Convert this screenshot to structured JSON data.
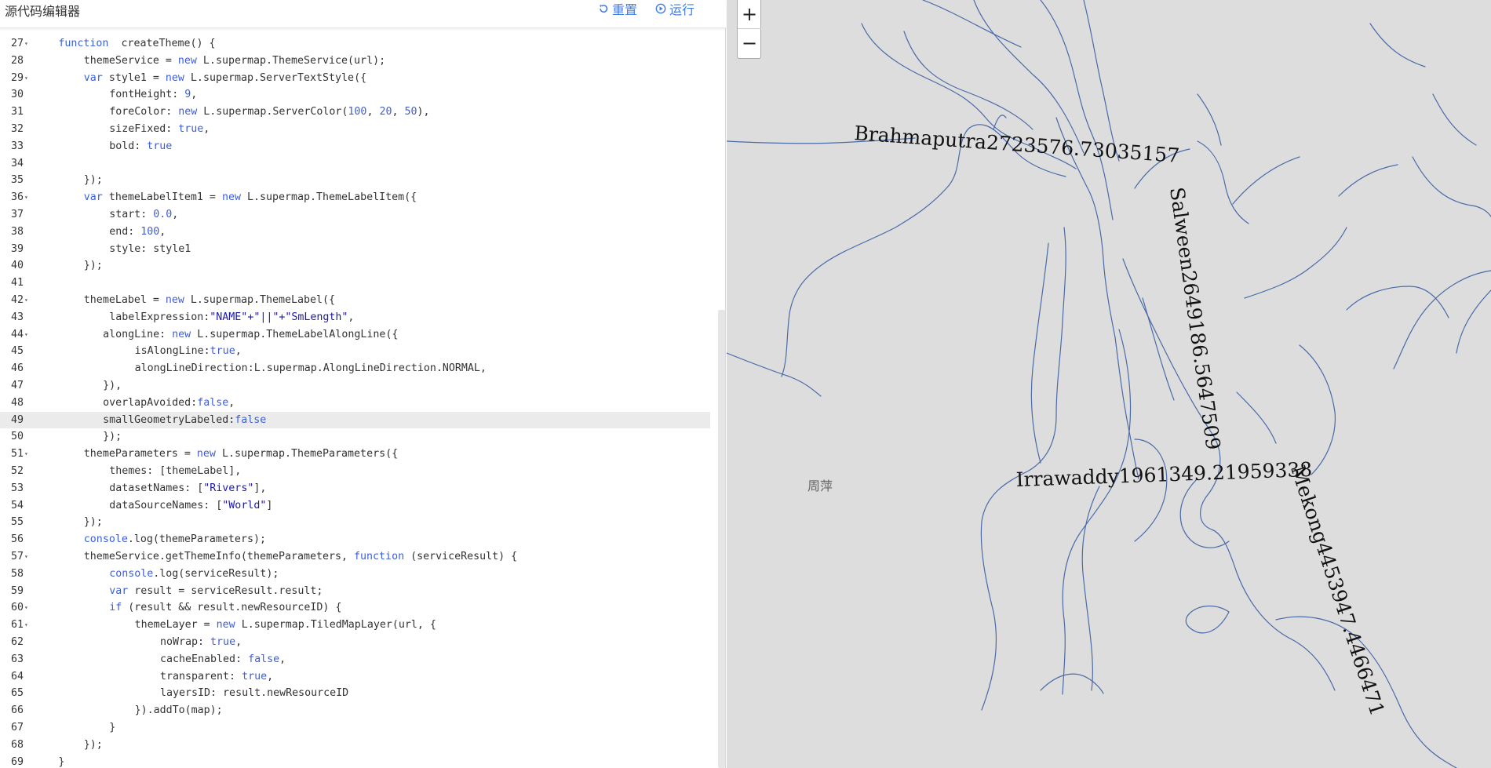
{
  "editor": {
    "title": "源代码编辑器",
    "reset_label": "重置",
    "run_label": "运行",
    "lines": [
      {
        "n": "27",
        "fold": true,
        "indent": 4,
        "tokens": [
          [
            "kw",
            "function"
          ],
          [
            "",
            "  createTheme() {"
          ]
        ]
      },
      {
        "n": "28",
        "fold": false,
        "indent": 8,
        "tokens": [
          [
            "",
            "themeService = "
          ],
          [
            "kw",
            "new"
          ],
          [
            "",
            " L.supermap.ThemeService(url);"
          ]
        ]
      },
      {
        "n": "29",
        "fold": true,
        "indent": 8,
        "tokens": [
          [
            "kw",
            "var"
          ],
          [
            "",
            " style1 = "
          ],
          [
            "kw",
            "new"
          ],
          [
            "",
            " L.supermap.ServerTextStyle({"
          ]
        ]
      },
      {
        "n": "30",
        "fold": false,
        "indent": 12,
        "tokens": [
          [
            "",
            "fontHeight: "
          ],
          [
            "num",
            "9"
          ],
          [
            "",
            ","
          ]
        ]
      },
      {
        "n": "31",
        "fold": false,
        "indent": 12,
        "tokens": [
          [
            "",
            "foreColor: "
          ],
          [
            "kw",
            "new"
          ],
          [
            "",
            " L.supermap.ServerColor("
          ],
          [
            "num",
            "100"
          ],
          [
            "",
            ", "
          ],
          [
            "num",
            "20"
          ],
          [
            "",
            ", "
          ],
          [
            "num",
            "50"
          ],
          [
            "",
            "),"
          ]
        ]
      },
      {
        "n": "32",
        "fold": false,
        "indent": 12,
        "tokens": [
          [
            "",
            "sizeFixed: "
          ],
          [
            "kw",
            "true"
          ],
          [
            "",
            ","
          ]
        ]
      },
      {
        "n": "33",
        "fold": false,
        "indent": 12,
        "tokens": [
          [
            "",
            "bold: "
          ],
          [
            "kw",
            "true"
          ]
        ]
      },
      {
        "n": "34",
        "fold": false,
        "indent": 0,
        "tokens": []
      },
      {
        "n": "35",
        "fold": false,
        "indent": 8,
        "tokens": [
          [
            "",
            "});"
          ]
        ]
      },
      {
        "n": "36",
        "fold": true,
        "indent": 8,
        "tokens": [
          [
            "kw",
            "var"
          ],
          [
            "",
            " themeLabelItem1 = "
          ],
          [
            "kw",
            "new"
          ],
          [
            "",
            " L.supermap.ThemeLabelItem({"
          ]
        ]
      },
      {
        "n": "37",
        "fold": false,
        "indent": 12,
        "tokens": [
          [
            "",
            "start: "
          ],
          [
            "num",
            "0.0"
          ],
          [
            "",
            ","
          ]
        ]
      },
      {
        "n": "38",
        "fold": false,
        "indent": 12,
        "tokens": [
          [
            "",
            "end: "
          ],
          [
            "num",
            "100"
          ],
          [
            "",
            ","
          ]
        ]
      },
      {
        "n": "39",
        "fold": false,
        "indent": 12,
        "tokens": [
          [
            "",
            "style: style1"
          ]
        ]
      },
      {
        "n": "40",
        "fold": false,
        "indent": 8,
        "tokens": [
          [
            "",
            "});"
          ]
        ]
      },
      {
        "n": "41",
        "fold": false,
        "indent": 0,
        "tokens": []
      },
      {
        "n": "42",
        "fold": true,
        "indent": 8,
        "tokens": [
          [
            "",
            "themeLabel = "
          ],
          [
            "kw",
            "new"
          ],
          [
            "",
            " L.supermap.ThemeLabel({"
          ]
        ]
      },
      {
        "n": "43",
        "fold": false,
        "indent": 12,
        "tokens": [
          [
            "",
            "labelExpression:"
          ],
          [
            "str",
            "\"NAME\"+\"||\"+\"SmLength\""
          ],
          [
            "",
            ","
          ]
        ]
      },
      {
        "n": "44",
        "fold": true,
        "indent": 11,
        "tokens": [
          [
            "",
            "alongLine: "
          ],
          [
            "kw",
            "new"
          ],
          [
            "",
            " L.supermap.ThemeLabelAlongLine({"
          ]
        ]
      },
      {
        "n": "45",
        "fold": false,
        "indent": 16,
        "tokens": [
          [
            "",
            "isAlongLine:"
          ],
          [
            "kw",
            "true"
          ],
          [
            "",
            ","
          ]
        ]
      },
      {
        "n": "46",
        "fold": false,
        "indent": 16,
        "tokens": [
          [
            "",
            "alongLineDirection:L.supermap.AlongLineDirection.NORMAL,"
          ]
        ]
      },
      {
        "n": "47",
        "fold": false,
        "indent": 11,
        "tokens": [
          [
            "",
            "}),"
          ]
        ]
      },
      {
        "n": "48",
        "fold": false,
        "indent": 11,
        "tokens": [
          [
            "",
            "overlapAvoided:"
          ],
          [
            "kw",
            "false"
          ],
          [
            "",
            ","
          ]
        ]
      },
      {
        "n": "49",
        "fold": false,
        "indent": 11,
        "active": true,
        "tokens": [
          [
            "",
            "smallGeometryLabeled:"
          ],
          [
            "kw",
            "false"
          ]
        ]
      },
      {
        "n": "50",
        "fold": false,
        "indent": 11,
        "tokens": [
          [
            "",
            "});"
          ]
        ]
      },
      {
        "n": "51",
        "fold": true,
        "indent": 8,
        "tokens": [
          [
            "",
            "themeParameters = "
          ],
          [
            "kw",
            "new"
          ],
          [
            "",
            " L.supermap.ThemeParameters({"
          ]
        ]
      },
      {
        "n": "52",
        "fold": false,
        "indent": 12,
        "tokens": [
          [
            "",
            "themes: [themeLabel],"
          ]
        ]
      },
      {
        "n": "53",
        "fold": false,
        "indent": 12,
        "tokens": [
          [
            "",
            "datasetNames: ["
          ],
          [
            "str",
            "\"Rivers\""
          ],
          [
            "",
            "],"
          ]
        ]
      },
      {
        "n": "54",
        "fold": false,
        "indent": 12,
        "tokens": [
          [
            "",
            "dataSourceNames: ["
          ],
          [
            "str",
            "\"World\""
          ],
          [
            "",
            "]"
          ]
        ]
      },
      {
        "n": "55",
        "fold": false,
        "indent": 8,
        "tokens": [
          [
            "",
            "});"
          ]
        ]
      },
      {
        "n": "56",
        "fold": false,
        "indent": 8,
        "tokens": [
          [
            "kw",
            "console"
          ],
          [
            "",
            ".log(themeParameters);"
          ]
        ]
      },
      {
        "n": "57",
        "fold": true,
        "indent": 8,
        "tokens": [
          [
            "",
            "themeService.getThemeInfo(themeParameters, "
          ],
          [
            "kw",
            "function"
          ],
          [
            "",
            " (serviceResult) {"
          ]
        ]
      },
      {
        "n": "58",
        "fold": false,
        "indent": 12,
        "tokens": [
          [
            "kw",
            "console"
          ],
          [
            "",
            ".log(serviceResult);"
          ]
        ]
      },
      {
        "n": "59",
        "fold": false,
        "indent": 12,
        "tokens": [
          [
            "kw",
            "var"
          ],
          [
            "",
            " result = serviceResult.result;"
          ]
        ]
      },
      {
        "n": "60",
        "fold": true,
        "indent": 12,
        "tokens": [
          [
            "kw",
            "if"
          ],
          [
            "",
            " (result && result.newResourceID) {"
          ]
        ]
      },
      {
        "n": "61",
        "fold": true,
        "indent": 16,
        "tokens": [
          [
            "",
            "themeLayer = "
          ],
          [
            "kw",
            "new"
          ],
          [
            "",
            " L.supermap.TiledMapLayer(url, {"
          ]
        ]
      },
      {
        "n": "62",
        "fold": false,
        "indent": 20,
        "tokens": [
          [
            "",
            "noWrap: "
          ],
          [
            "kw",
            "true"
          ],
          [
            "",
            ","
          ]
        ]
      },
      {
        "n": "63",
        "fold": false,
        "indent": 20,
        "tokens": [
          [
            "",
            "cacheEnabled: "
          ],
          [
            "kw",
            "false"
          ],
          [
            "",
            ","
          ]
        ]
      },
      {
        "n": "64",
        "fold": false,
        "indent": 20,
        "tokens": [
          [
            "",
            "transparent: "
          ],
          [
            "kw",
            "true"
          ],
          [
            "",
            ","
          ]
        ]
      },
      {
        "n": "65",
        "fold": false,
        "indent": 20,
        "tokens": [
          [
            "",
            "layersID: result.newResourceID"
          ]
        ]
      },
      {
        "n": "66",
        "fold": false,
        "indent": 16,
        "tokens": [
          [
            "",
            "}).addTo(map);"
          ]
        ]
      },
      {
        "n": "67",
        "fold": false,
        "indent": 12,
        "tokens": [
          [
            "",
            "}"
          ]
        ]
      },
      {
        "n": "68",
        "fold": false,
        "indent": 8,
        "tokens": [
          [
            "",
            "});"
          ]
        ]
      },
      {
        "n": "69",
        "fold": false,
        "indent": 4,
        "tokens": [
          [
            "",
            "}"
          ]
        ]
      }
    ]
  },
  "map": {
    "zoom_in_label": "+",
    "zoom_out_label": "−",
    "place_label": "周萍",
    "river_labels": {
      "brahmaputra": "Brahmaputra2723576.73035157",
      "salween": "Salween2649186.5647509",
      "irrawaddy": "Irrawaddy1961349.21959338",
      "mekong": "Mekong4453947.4466471"
    },
    "colors": {
      "background": "#dddddd",
      "river": "#4a6aa8",
      "accent": "#3f7ee8"
    }
  }
}
